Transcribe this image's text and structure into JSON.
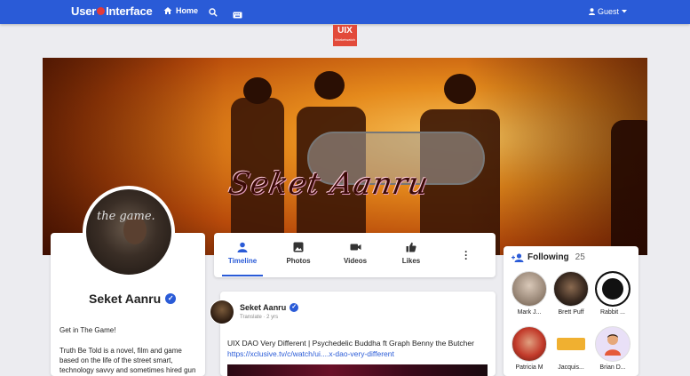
{
  "navbar": {
    "brand": {
      "part1": "User",
      "part2": "Interface"
    },
    "home_label": "Home",
    "guest_label": "Guest"
  },
  "logo": {
    "title": "UIX",
    "subtitle": "Marketwatch"
  },
  "cover": {
    "title": "Seket Aanru"
  },
  "profile": {
    "name": "Seket Aanru",
    "avatar_caption": "the game.",
    "tagline": "Get in The Game!",
    "bio": "Truth Be Told is a novel, film and game based on the life of the street smart, technology savvy and sometimes hired gun"
  },
  "tabs": [
    {
      "label": "Timeline",
      "icon": "person-icon",
      "active": true
    },
    {
      "label": "Photos",
      "icon": "image-icon",
      "active": false
    },
    {
      "label": "Videos",
      "icon": "video-icon",
      "active": false
    },
    {
      "label": "Likes",
      "icon": "thumbs-up-icon",
      "active": false
    }
  ],
  "post": {
    "author": "Seket Aanru",
    "translate": "Translate",
    "time": "2 yrs",
    "text": "UIX DAO Very Different | Psychedelic Buddha ft Graph Benny the Butcher",
    "link": "https://xclusive.tv/c/watch/ui....x-dao-very-different"
  },
  "following": {
    "title": "Following",
    "count": "25",
    "people": [
      {
        "name": "Mark J...",
        "color": "#b9a99a"
      },
      {
        "name": "Brett Puff",
        "color": "#3a2a20"
      },
      {
        "name": "Rabbit ...",
        "color": "#111111"
      },
      {
        "name": "Patricia M",
        "color": "#c23a2a"
      },
      {
        "name": "Jacquis...",
        "color": "#f0b030"
      },
      {
        "name": "Brian D...",
        "color": "#e9e0f7"
      }
    ]
  },
  "colors": {
    "primary": "#2a5bd7",
    "logo": "#e24a3a"
  }
}
